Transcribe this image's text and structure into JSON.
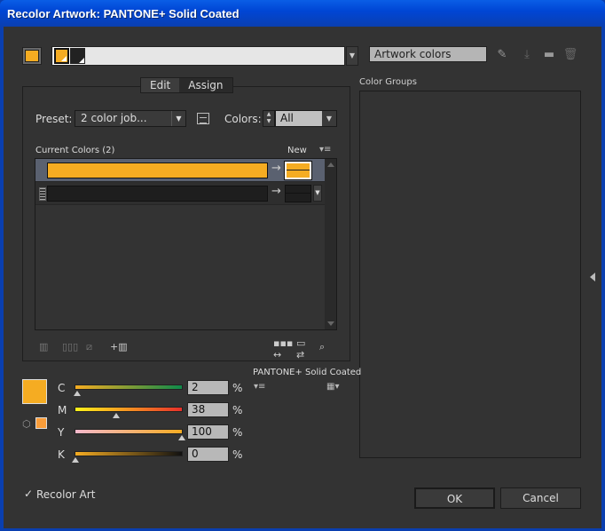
{
  "window": {
    "title": "Recolor Artwork: PANTONE+ Solid Coated"
  },
  "top": {
    "active_color": "#f5ac22",
    "strip_colors": [
      "#f5ac22",
      "#222222"
    ],
    "artwork_name": "Artwork colors",
    "icons": [
      "eyedropper-icon",
      "save-group-icon",
      "folder-icon",
      "trash-icon"
    ]
  },
  "color_groups": {
    "label": "Color Groups"
  },
  "tabs": [
    {
      "label": "Edit"
    },
    {
      "label": "Assign"
    }
  ],
  "preset": {
    "label": "Preset:",
    "value": "2 color job..."
  },
  "colors": {
    "label": "Colors:",
    "value": "All"
  },
  "current_colors": {
    "label": "Current Colors (2)",
    "new_label": "New",
    "rows": [
      {
        "current": "#f5ac22",
        "new": "#f5ac22"
      },
      {
        "current": "#1e1e1e",
        "new": "#1e1e1e"
      }
    ]
  },
  "library": {
    "name": "PANTONE+ Solid Coated"
  },
  "cmyk": [
    {
      "label": "C",
      "value": "2",
      "unit": "%"
    },
    {
      "label": "M",
      "value": "38",
      "unit": "%"
    },
    {
      "label": "Y",
      "value": "100",
      "unit": "%"
    },
    {
      "label": "K",
      "value": "0",
      "unit": "%"
    }
  ],
  "recolor_art": {
    "label": "Recolor Art",
    "checked": true
  },
  "buttons": {
    "ok": "OK",
    "cancel": "Cancel"
  }
}
